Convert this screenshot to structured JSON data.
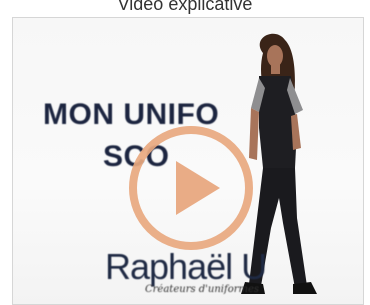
{
  "header": {
    "title": "Vidéo explicative"
  },
  "video": {
    "title_line1": "MON UNIFO",
    "title_line2": "SCO",
    "brand_name": "Raphaël U",
    "brand_tagline": "Créateurs d'uniformes",
    "play_icon": "play-icon",
    "accent_color": "#e8a87f"
  }
}
